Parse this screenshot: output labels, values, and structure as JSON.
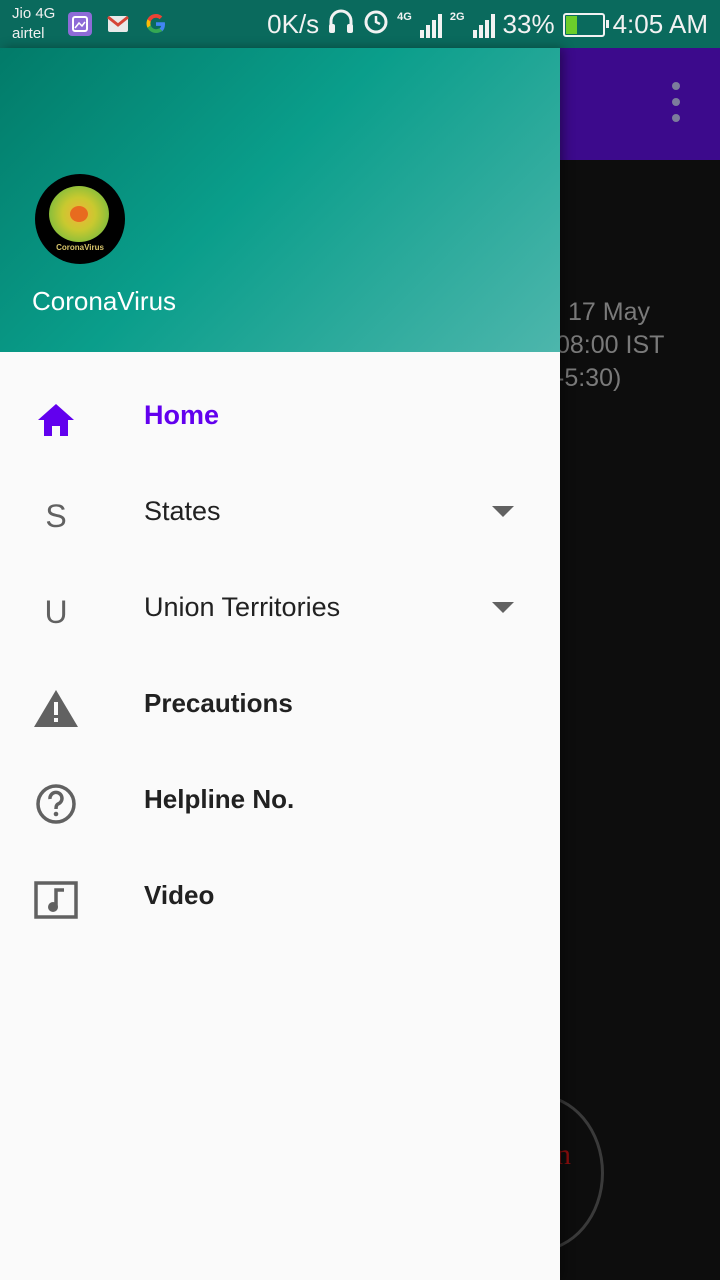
{
  "status_bar": {
    "carrier1": "Jio 4G",
    "carrier2": "airtel",
    "speed": "0K/s",
    "net1": "4G",
    "net2": "2G",
    "battery": "33%",
    "time": "4:05 AM"
  },
  "background": {
    "date_line1": "17 May",
    "date_line2": "08:00 IST",
    "date_line3": "-5:30)",
    "partial_text": "n"
  },
  "drawer": {
    "title": "CoronaVirus",
    "avatar_label": "CoronaVirus",
    "items": [
      {
        "icon": "home-icon",
        "label": "Home",
        "active": true
      },
      {
        "icon": "letter-S",
        "letter": "S",
        "label": "States",
        "expandable": true
      },
      {
        "icon": "letter-U",
        "letter": "U",
        "label": "Union Territories",
        "expandable": true
      },
      {
        "icon": "warning-icon",
        "label": "Precautions"
      },
      {
        "icon": "help-circle-icon",
        "label": "Helpline No."
      },
      {
        "icon": "music-video-icon",
        "label": "Video"
      }
    ],
    "accent_color": "#6200ee",
    "header_color": "#0a9e8b"
  }
}
